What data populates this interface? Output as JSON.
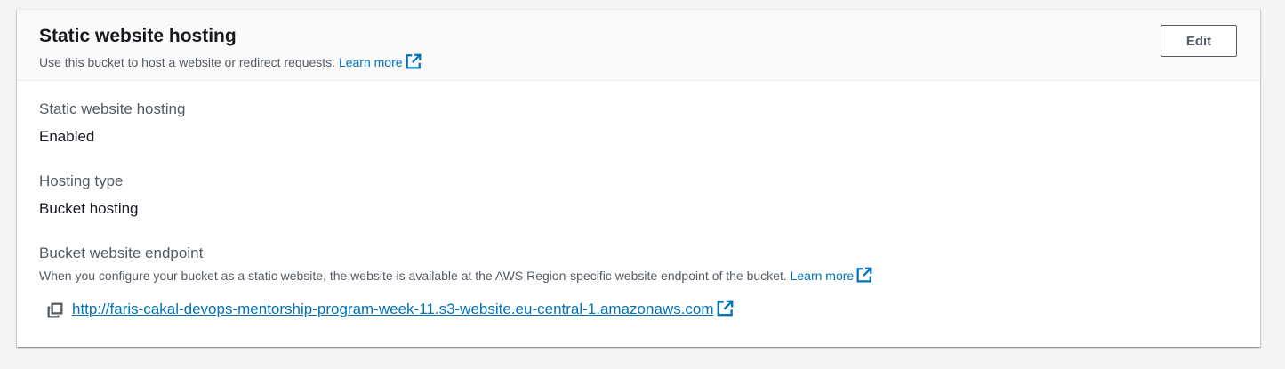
{
  "header": {
    "title": "Static website hosting",
    "description": "Use this bucket to host a website or redirect requests.",
    "learn_more": "Learn more",
    "edit_label": "Edit"
  },
  "fields": {
    "hosting": {
      "label": "Static website hosting",
      "value": "Enabled"
    },
    "hosting_type": {
      "label": "Hosting type",
      "value": "Bucket hosting"
    },
    "endpoint": {
      "label": "Bucket website endpoint",
      "description": "When you configure your bucket as a static website, the website is available at the AWS Region-specific website endpoint of the bucket.",
      "learn_more": "Learn more",
      "url": "http://faris-cakal-devops-mentorship-program-week-11.s3-website.eu-central-1.amazonaws.com"
    }
  },
  "icons": {
    "external": "external-link-icon",
    "copy": "copy-icon"
  },
  "colors": {
    "link": "#0073bb",
    "text": "#16191f",
    "secondary_text": "#545b64",
    "header_bg": "#fafafa",
    "page_bg": "#f2f3f3"
  }
}
